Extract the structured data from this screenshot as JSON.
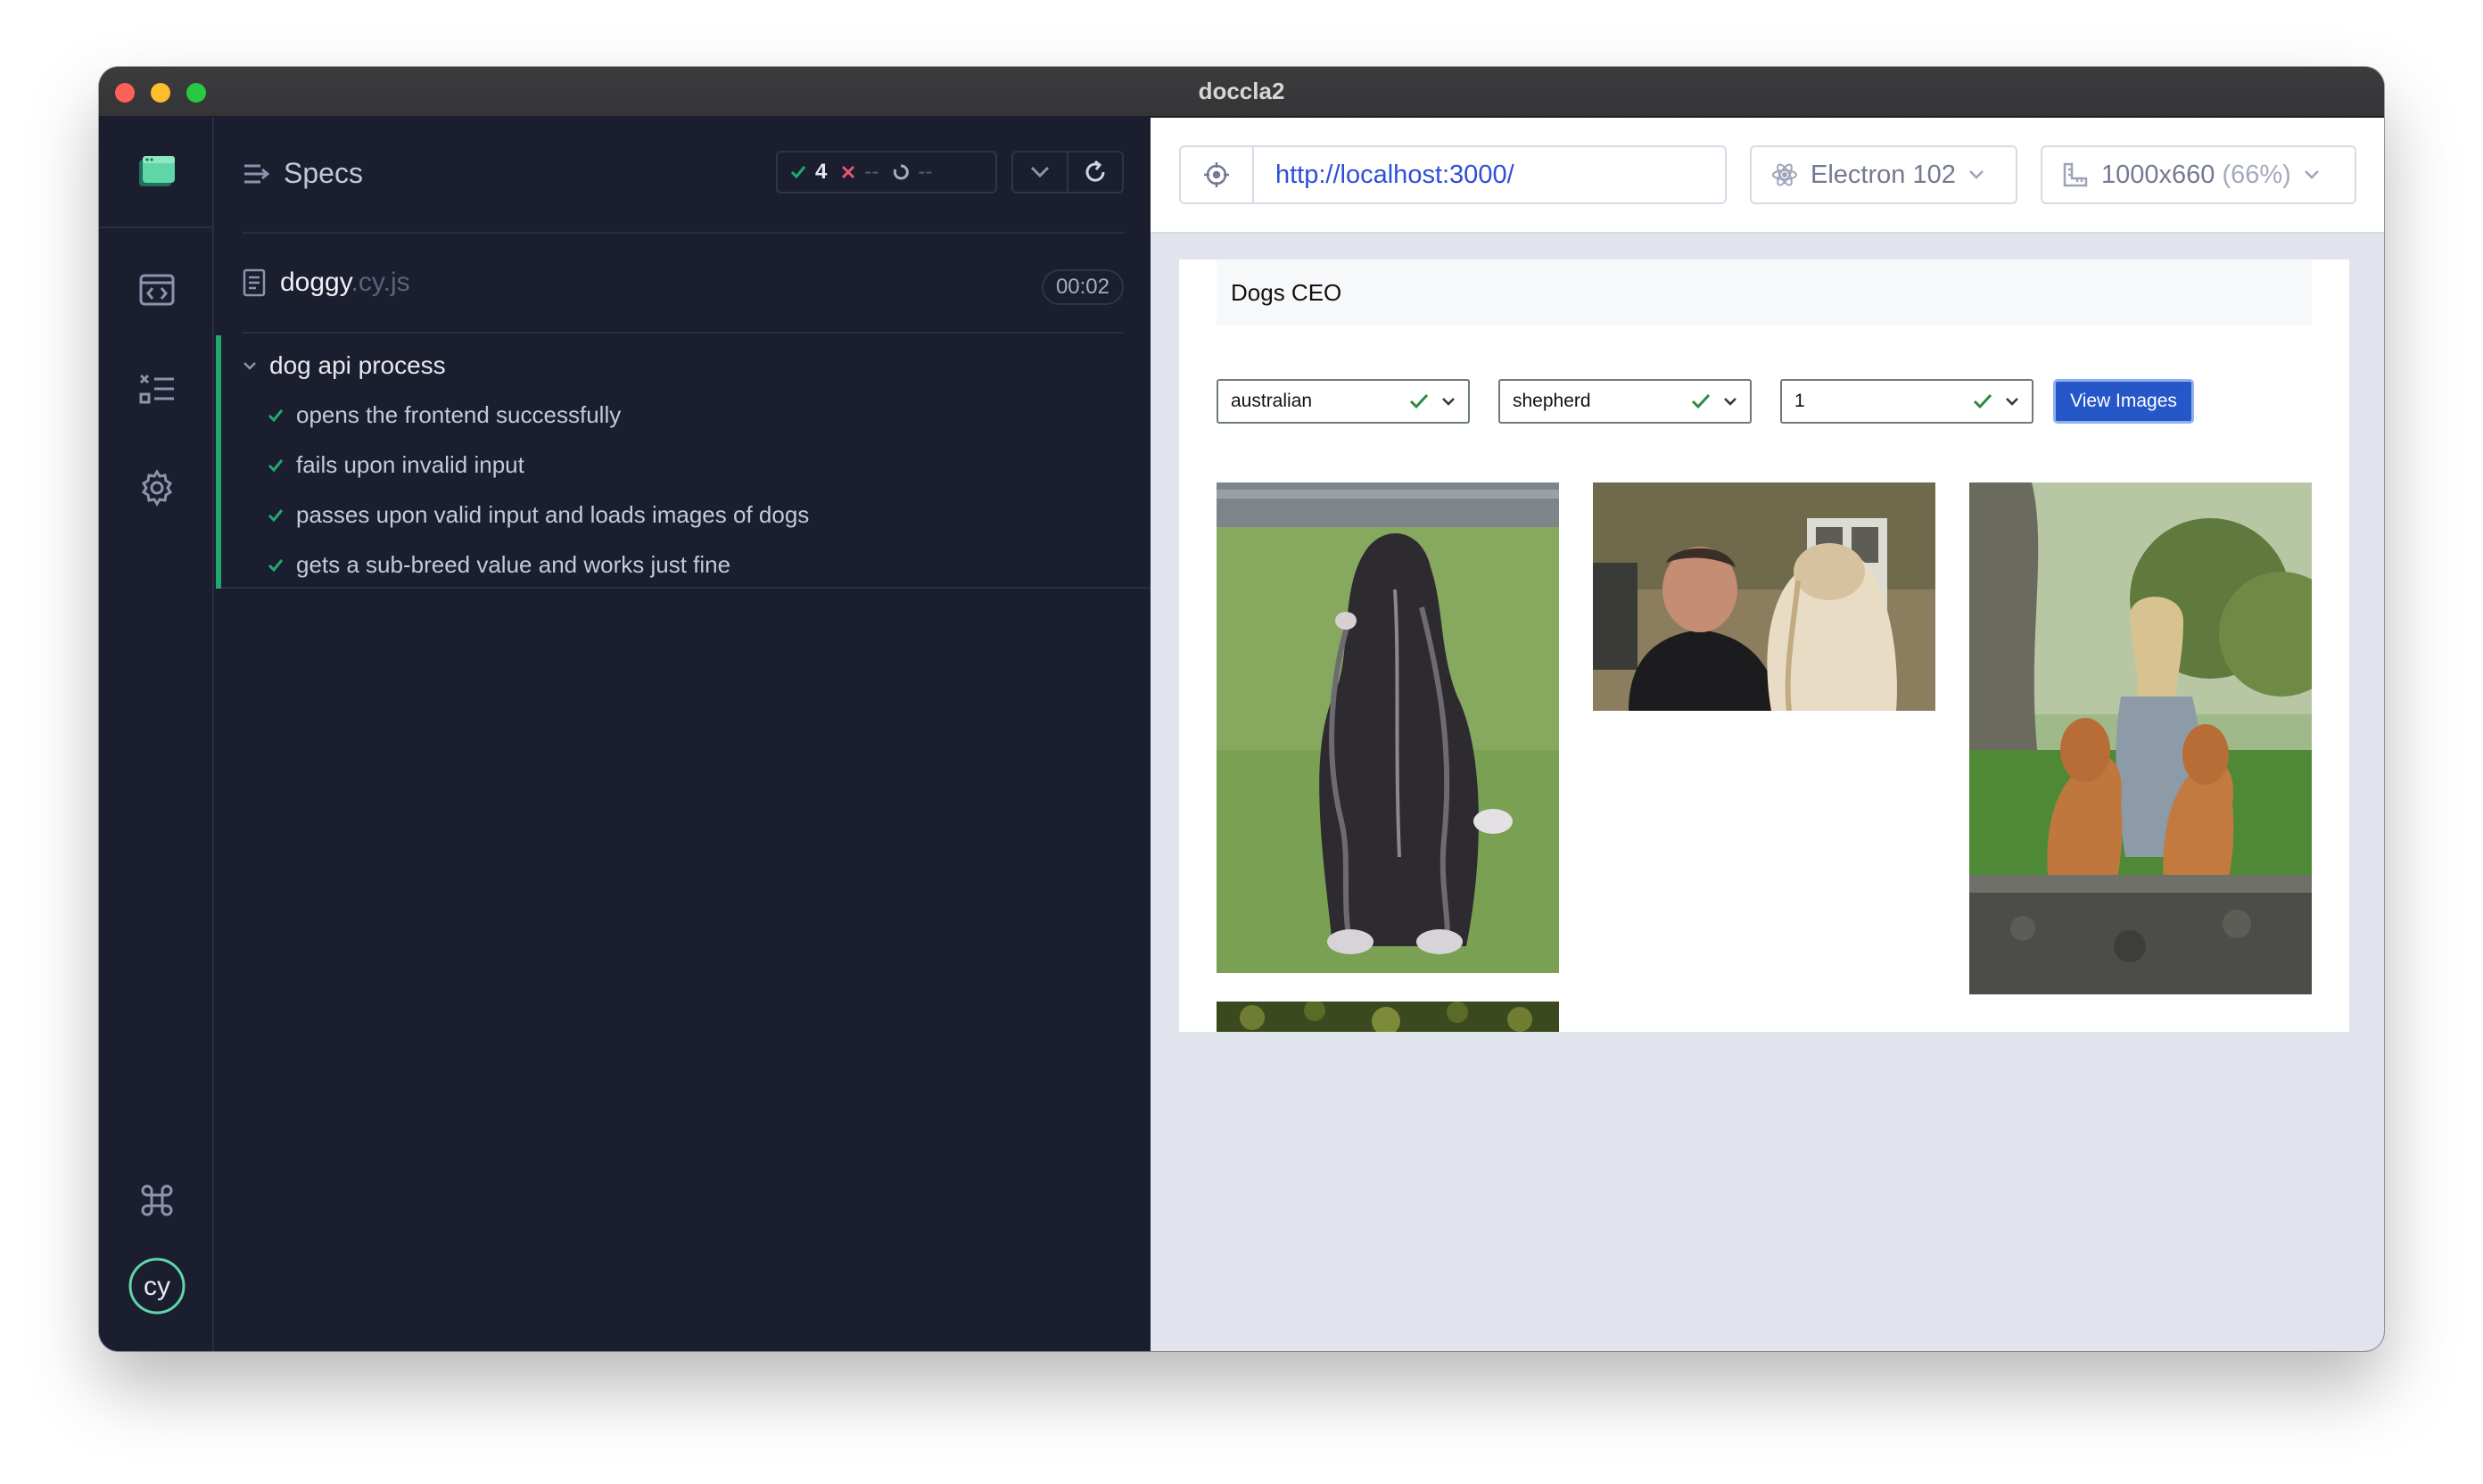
{
  "window": {
    "title": "doccla2"
  },
  "reporter": {
    "specs_label": "Specs",
    "stats": {
      "passed": "4",
      "failed": "--",
      "pending": "--"
    },
    "file": {
      "name": "doggy",
      "ext": ".cy.js",
      "duration": "00:02"
    },
    "suite": {
      "title": "dog api process",
      "tests": [
        "opens the frontend successfully",
        "fails upon invalid input",
        "passes upon valid input and loads images of dogs",
        "gets a sub-breed value and works just fine"
      ]
    }
  },
  "aut": {
    "url": "http://localhost:3000/",
    "browser": "Electron 102",
    "viewport": "1000x660",
    "viewport_scale": "(66%)",
    "app": {
      "brand": "Dogs CEO",
      "breed": "australian",
      "sub_breed": "shepherd",
      "count": "1",
      "view_button": "View Images"
    }
  },
  "colors": {
    "pass": "#1fa971",
    "fail": "#e45770",
    "accent_bar": "#1fa971",
    "primary_button": "#2657c9",
    "url_text": "#2e4fd6"
  },
  "icons": {
    "rail": [
      "cypress-app-icon",
      "specs-code-icon",
      "test-list-icon",
      "settings-gear-icon",
      "command-key-icon",
      "cypress-logo-icon"
    ]
  }
}
